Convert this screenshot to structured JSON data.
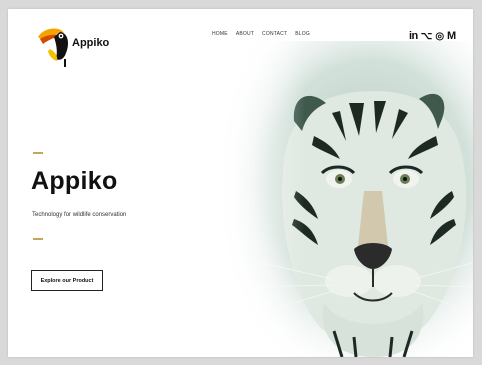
{
  "brand": {
    "name": "Appiko",
    "logo_icon": "toucan-icon"
  },
  "nav": {
    "items": [
      "HOME",
      "ABOUT",
      "CONTACT",
      "BLOG"
    ]
  },
  "social": [
    {
      "icon": "linkedin-icon",
      "glyph": "in"
    },
    {
      "icon": "github-icon",
      "glyph": "⌥"
    },
    {
      "icon": "dribbble-icon",
      "glyph": "◎"
    },
    {
      "icon": "medium-icon",
      "glyph": "M"
    }
  ],
  "hero": {
    "title": "Appiko",
    "subtitle": "Technology for wildlife conservation",
    "cta_label": "Explore our Product",
    "accent_color": "#c4a85a"
  },
  "illustration": {
    "subject": "tiger-face-illustration",
    "tint": "#6f9a88"
  }
}
